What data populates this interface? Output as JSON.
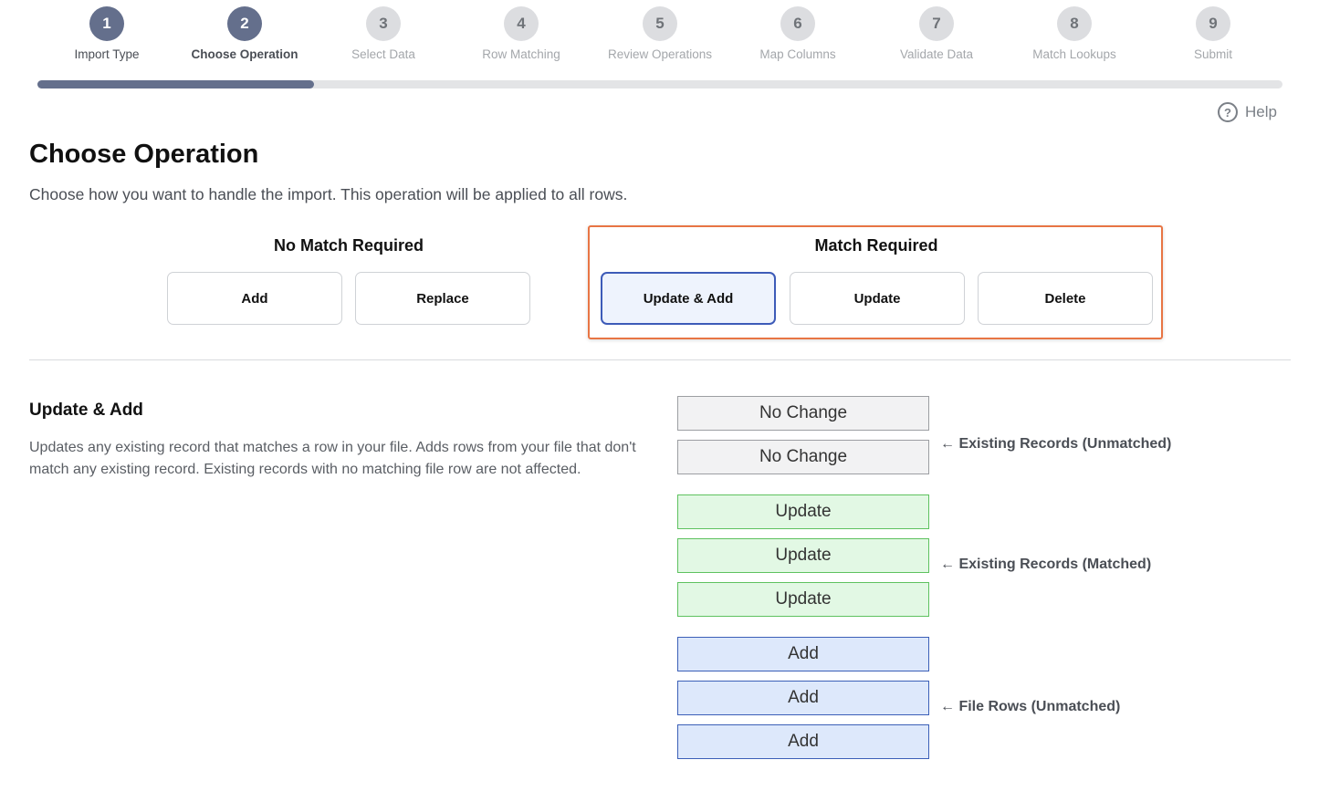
{
  "stepper": {
    "steps": [
      {
        "number": "1",
        "label": "Import Type"
      },
      {
        "number": "2",
        "label": "Choose Operation"
      },
      {
        "number": "3",
        "label": "Select Data"
      },
      {
        "number": "4",
        "label": "Row Matching"
      },
      {
        "number": "5",
        "label": "Review Operations"
      },
      {
        "number": "6",
        "label": "Map Columns"
      },
      {
        "number": "7",
        "label": "Validate Data"
      },
      {
        "number": "8",
        "label": "Match Lookups"
      },
      {
        "number": "9",
        "label": "Submit"
      }
    ],
    "current_step": 2,
    "progress_fraction": 0.222
  },
  "help": {
    "icon": "question-circle-icon",
    "label": "Help"
  },
  "header": {
    "title": "Choose Operation",
    "subtitle": "Choose how you want to handle the import. This operation will be applied to all rows."
  },
  "operations": {
    "no_match": {
      "title": "No Match Required",
      "buttons": [
        "Add",
        "Replace"
      ]
    },
    "match": {
      "title": "Match Required",
      "buttons": [
        "Update & Add",
        "Update",
        "Delete"
      ]
    },
    "selected": "Update & Add"
  },
  "description": {
    "title": "Update & Add",
    "text": "Updates any existing record that matches a row in your file. Adds rows from your file that don't match any existing record. Existing records with no matching file row are not affected."
  },
  "diagram": {
    "unmatched_existing": {
      "boxes": [
        "No Change",
        "No Change"
      ],
      "label": "← Existing Records (Unmatched)"
    },
    "matched_existing": {
      "boxes": [
        "Update",
        "Update",
        "Update"
      ],
      "label": "← Existing Records (Matched)"
    },
    "unmatched_file": {
      "boxes": [
        "Add",
        "Add",
        "Add"
      ],
      "label": "← File Rows (Unmatched)"
    }
  },
  "colors": {
    "step_done": "#646f8c",
    "step_pending": "#dcdde0",
    "highlight_border": "#e87544",
    "selected_border": "#3d5bb8",
    "no_change_fill": "#f2f2f3",
    "update_fill": "#e2f8e4",
    "add_fill": "#dde8fb"
  }
}
